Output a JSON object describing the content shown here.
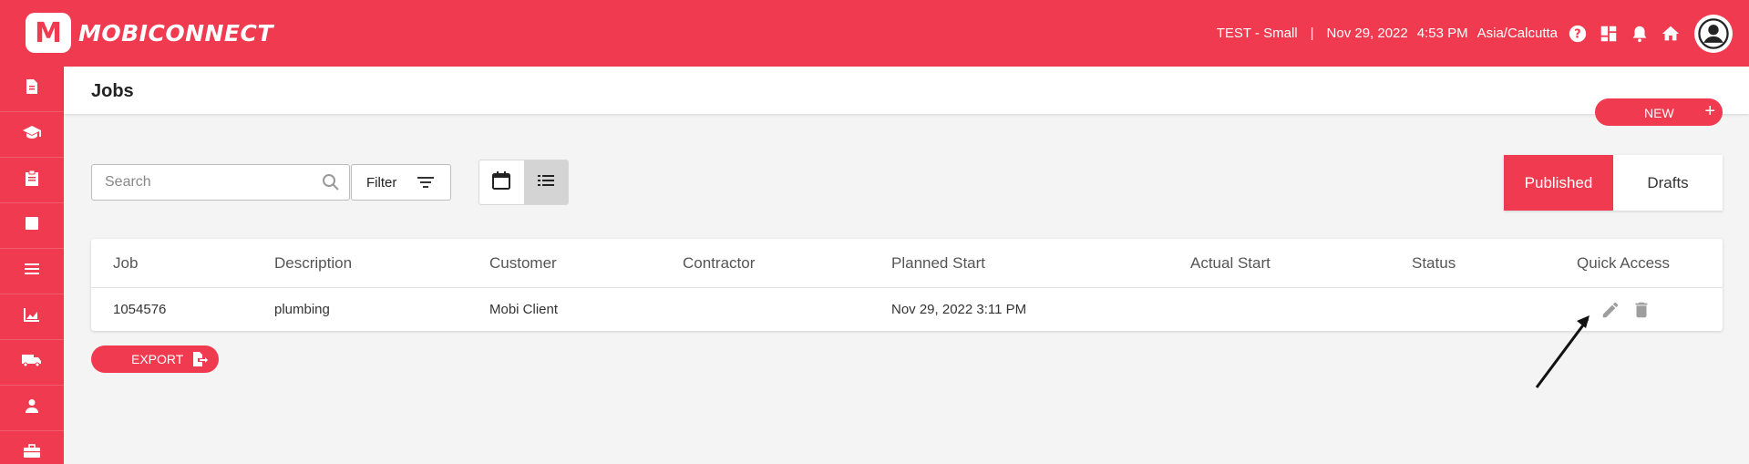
{
  "app": {
    "brand_name": "MOBICONNECT",
    "logo_letter": "M",
    "org": "TEST - Small",
    "separator": "|",
    "date": "Nov 29, 2022",
    "time": "4:53 PM",
    "timezone": "Asia/Calcutta",
    "accent_color": "#f03a4f"
  },
  "topbar_icons": [
    "help-icon",
    "dashboard-icon",
    "bell-icon",
    "home-icon",
    "user-avatar-icon"
  ],
  "sidebar": {
    "items": [
      {
        "icon": "document-icon"
      },
      {
        "icon": "graduation-cap-icon"
      },
      {
        "icon": "clipboard-icon"
      },
      {
        "icon": "square-icon"
      },
      {
        "icon": "list-icon"
      },
      {
        "icon": "chart-icon"
      },
      {
        "icon": "truck-icon"
      },
      {
        "icon": "person-icon"
      },
      {
        "icon": "briefcase-icon"
      }
    ]
  },
  "page": {
    "title": "Jobs",
    "new_label": "NEW",
    "new_plus": "+"
  },
  "toolbar": {
    "search_placeholder": "Search",
    "filter_label": "Filter",
    "view_modes": [
      "calendar-view",
      "list-view"
    ],
    "active_view": "list-view",
    "published_label": "Published",
    "drafts_label": "Drafts",
    "active_tab": "Published"
  },
  "table": {
    "headers": {
      "job": "Job",
      "description": "Description",
      "customer": "Customer",
      "contractor": "Contractor",
      "planned_start": "Planned Start",
      "actual_start": "Actual Start",
      "status": "Status",
      "quick_access": "Quick Access"
    },
    "rows": [
      {
        "job": "1054576",
        "description": "plumbing",
        "customer": "Mobi Client",
        "contractor": "",
        "planned_start": "Nov 29, 2022 3:11 PM",
        "actual_start": "",
        "status": "",
        "actions": [
          "edit-icon",
          "delete-icon"
        ]
      }
    ]
  },
  "export": {
    "label": "EXPORT"
  }
}
